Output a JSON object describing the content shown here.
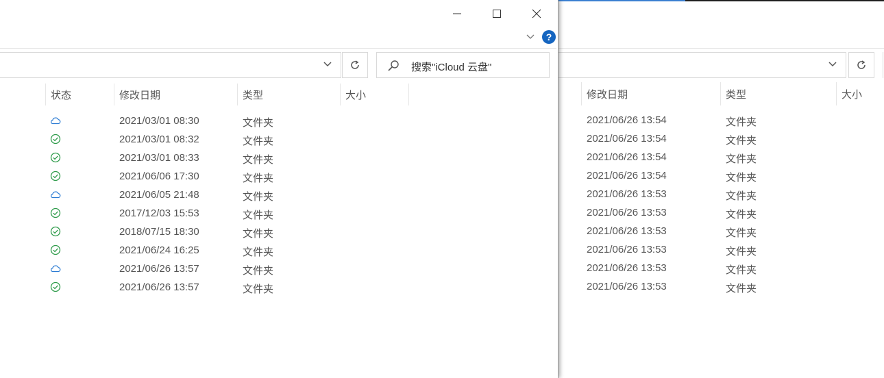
{
  "back_window": {
    "columns": {
      "modified": "修改日期",
      "type": "类型",
      "size": "大小"
    },
    "rows": [
      {
        "date": "2021/06/26 13:54",
        "type": "文件夹"
      },
      {
        "date": "2021/06/26 13:54",
        "type": "文件夹"
      },
      {
        "date": "2021/06/26 13:54",
        "type": "文件夹"
      },
      {
        "date": "2021/06/26 13:54",
        "type": "文件夹"
      },
      {
        "date": "2021/06/26 13:53",
        "type": "文件夹"
      },
      {
        "date": "2021/06/26 13:53",
        "type": "文件夹"
      },
      {
        "date": "2021/06/26 13:53",
        "type": "文件夹"
      },
      {
        "date": "2021/06/26 13:53",
        "type": "文件夹"
      },
      {
        "date": "2021/06/26 13:53",
        "type": "文件夹"
      },
      {
        "date": "2021/06/26 13:53",
        "type": "文件夹"
      }
    ]
  },
  "front_window": {
    "search_placeholder": "搜索\"iCloud 云盘\"",
    "help_label": "?",
    "columns": {
      "status": "状态",
      "modified": "修改日期",
      "type": "类型",
      "size": "大小"
    },
    "rows": [
      {
        "status": "cloud",
        "date": "2021/03/01 08:30",
        "type": "文件夹"
      },
      {
        "status": "synced",
        "date": "2021/03/01 08:32",
        "type": "文件夹"
      },
      {
        "status": "synced",
        "date": "2021/03/01 08:33",
        "type": "文件夹"
      },
      {
        "status": "synced",
        "date": "2021/06/06 17:30",
        "type": "文件夹"
      },
      {
        "status": "cloud",
        "date": "2021/06/05 21:48",
        "type": "文件夹"
      },
      {
        "status": "synced",
        "date": "2017/12/03 15:53",
        "type": "文件夹"
      },
      {
        "status": "synced",
        "date": "2018/07/15 18:30",
        "type": "文件夹"
      },
      {
        "status": "synced",
        "date": "2021/06/24 16:25",
        "type": "文件夹"
      },
      {
        "status": "cloud",
        "date": "2021/06/26 13:57",
        "type": "文件夹"
      },
      {
        "status": "synced",
        "date": "2021/06/26 13:57",
        "type": "文件夹"
      }
    ]
  },
  "colors": {
    "cloud_icon": "#2b7bd3",
    "synced_icon": "#2e9b4a",
    "help_badge": "#1565c0"
  }
}
